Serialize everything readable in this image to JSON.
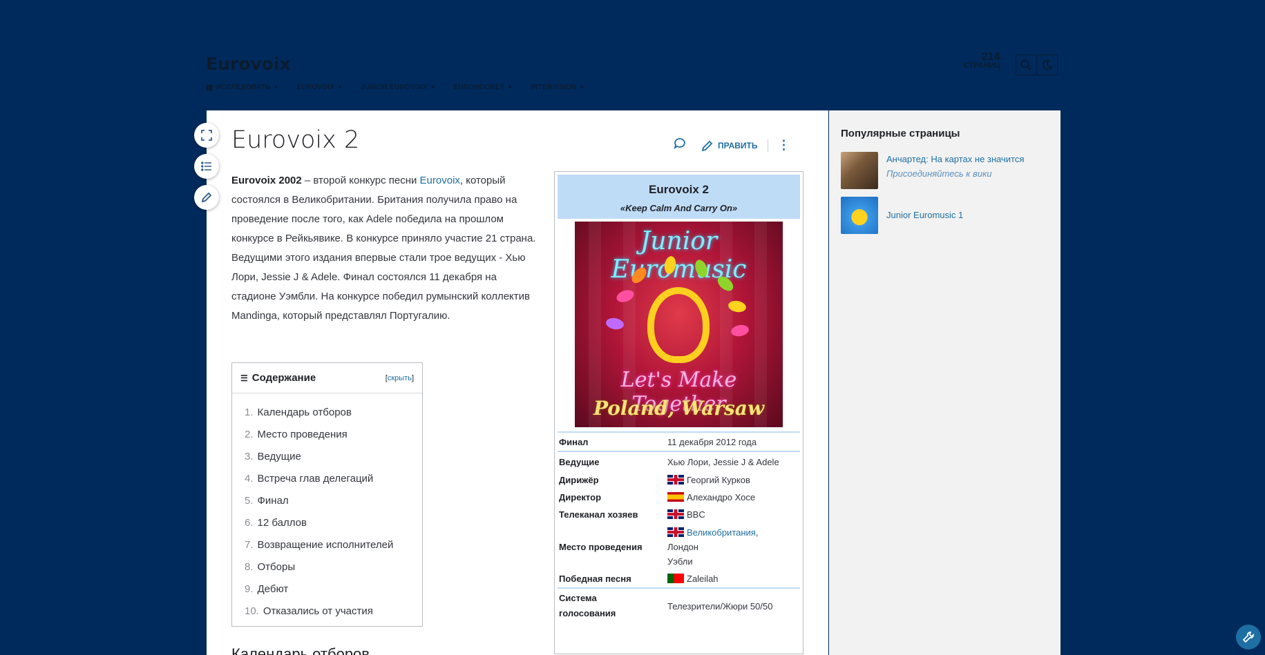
{
  "site": {
    "title": "Eurovoix",
    "page_count_num": "214",
    "page_count_label": "СТРАНИЦ",
    "nav": [
      {
        "label": "ИССЛЕДОВАТЬ"
      },
      {
        "label": "EUROVOIX"
      },
      {
        "label": "JUNIOR EUROVOIX"
      },
      {
        "label": "EUROHOCKEY"
      },
      {
        "label": "INTERVISION"
      }
    ]
  },
  "page": {
    "title": "Eurovoix 2",
    "edit_label": "ПРАВИТЬ",
    "intro_bold": "Eurovoix 2002",
    "intro_before_link": " – второй конкурс песни ",
    "intro_link": "Eurovoix",
    "intro_after_link": ", который состоялся в Великобритании. Британия получила право на проведение после того, как Adele победила на прошлом конкурсе в Рейкьявике. В конкурсе приняло участие 21 страна. Ведущими этого издания впервые стали трое ведущих - Хью Лори, Jessie J & Adele. Финал состоялся 11 декабря на стадионе Уэмбли. На конкурсе победил румынский коллектив Mandinga, который представлял Португалию.",
    "next_heading": "Календарь отборов"
  },
  "toc": {
    "title": "Содержание",
    "toggle_open": "[",
    "toggle_link": "скрыть",
    "toggle_close": "]",
    "items": [
      {
        "n": "1.",
        "label": "Календарь отборов"
      },
      {
        "n": "2.",
        "label": "Место проведения"
      },
      {
        "n": "3.",
        "label": "Ведущие"
      },
      {
        "n": "4.",
        "label": "Встреча глав делегаций"
      },
      {
        "n": "5.",
        "label": "Финал"
      },
      {
        "n": "6.",
        "label": "12 баллов"
      },
      {
        "n": "7.",
        "label": "Возвращение исполнителей"
      },
      {
        "n": "8.",
        "label": "Отборы"
      },
      {
        "n": "9.",
        "label": "Дебют"
      },
      {
        "n": "10.",
        "label": "Отказались от участия"
      }
    ]
  },
  "infobox": {
    "title": "Eurovoix 2",
    "slogan": "«Keep Calm And Carry On»",
    "logo": {
      "top": "Junior Euromusic",
      "mid": "Let's Make Together",
      "bot": "Poland, Warsaw"
    },
    "final_label": "Финал",
    "final_value": "11 декабря 2012 года",
    "hosts_label": "Ведущие",
    "hosts_value": "Хью Лори, Jessie J & Adele",
    "conductor_label": "Дирижёр",
    "conductor_value": "Георгий Курков",
    "director_label": "Директор",
    "director_value": "Алехандро Хосе",
    "broadcaster_label": "Телеканал хозяев",
    "broadcaster_value": "BBC",
    "venue_label": "Место проведения",
    "venue_country": "Великобритания",
    "venue_comma": ",",
    "venue_city": "Лондон",
    "venue_place": "Уэбли",
    "song_label": "Победная песня",
    "song_value": "Zaleilah",
    "voting_label_1": "Система",
    "voting_label_2": "голосования",
    "voting_value": "Телезрители/Жюри 50/50"
  },
  "rail": {
    "title": "Популярные страницы",
    "items": [
      {
        "title": "Анчартед: На картах не значится",
        "sub": "Присоединяйтесь к вики"
      },
      {
        "title": "Junior Euromusic 1",
        "sub": ""
      }
    ]
  },
  "colors": {
    "background": "#002a5c",
    "accent": "#1e6fa3",
    "infobox_header": "#bfdcf7"
  }
}
